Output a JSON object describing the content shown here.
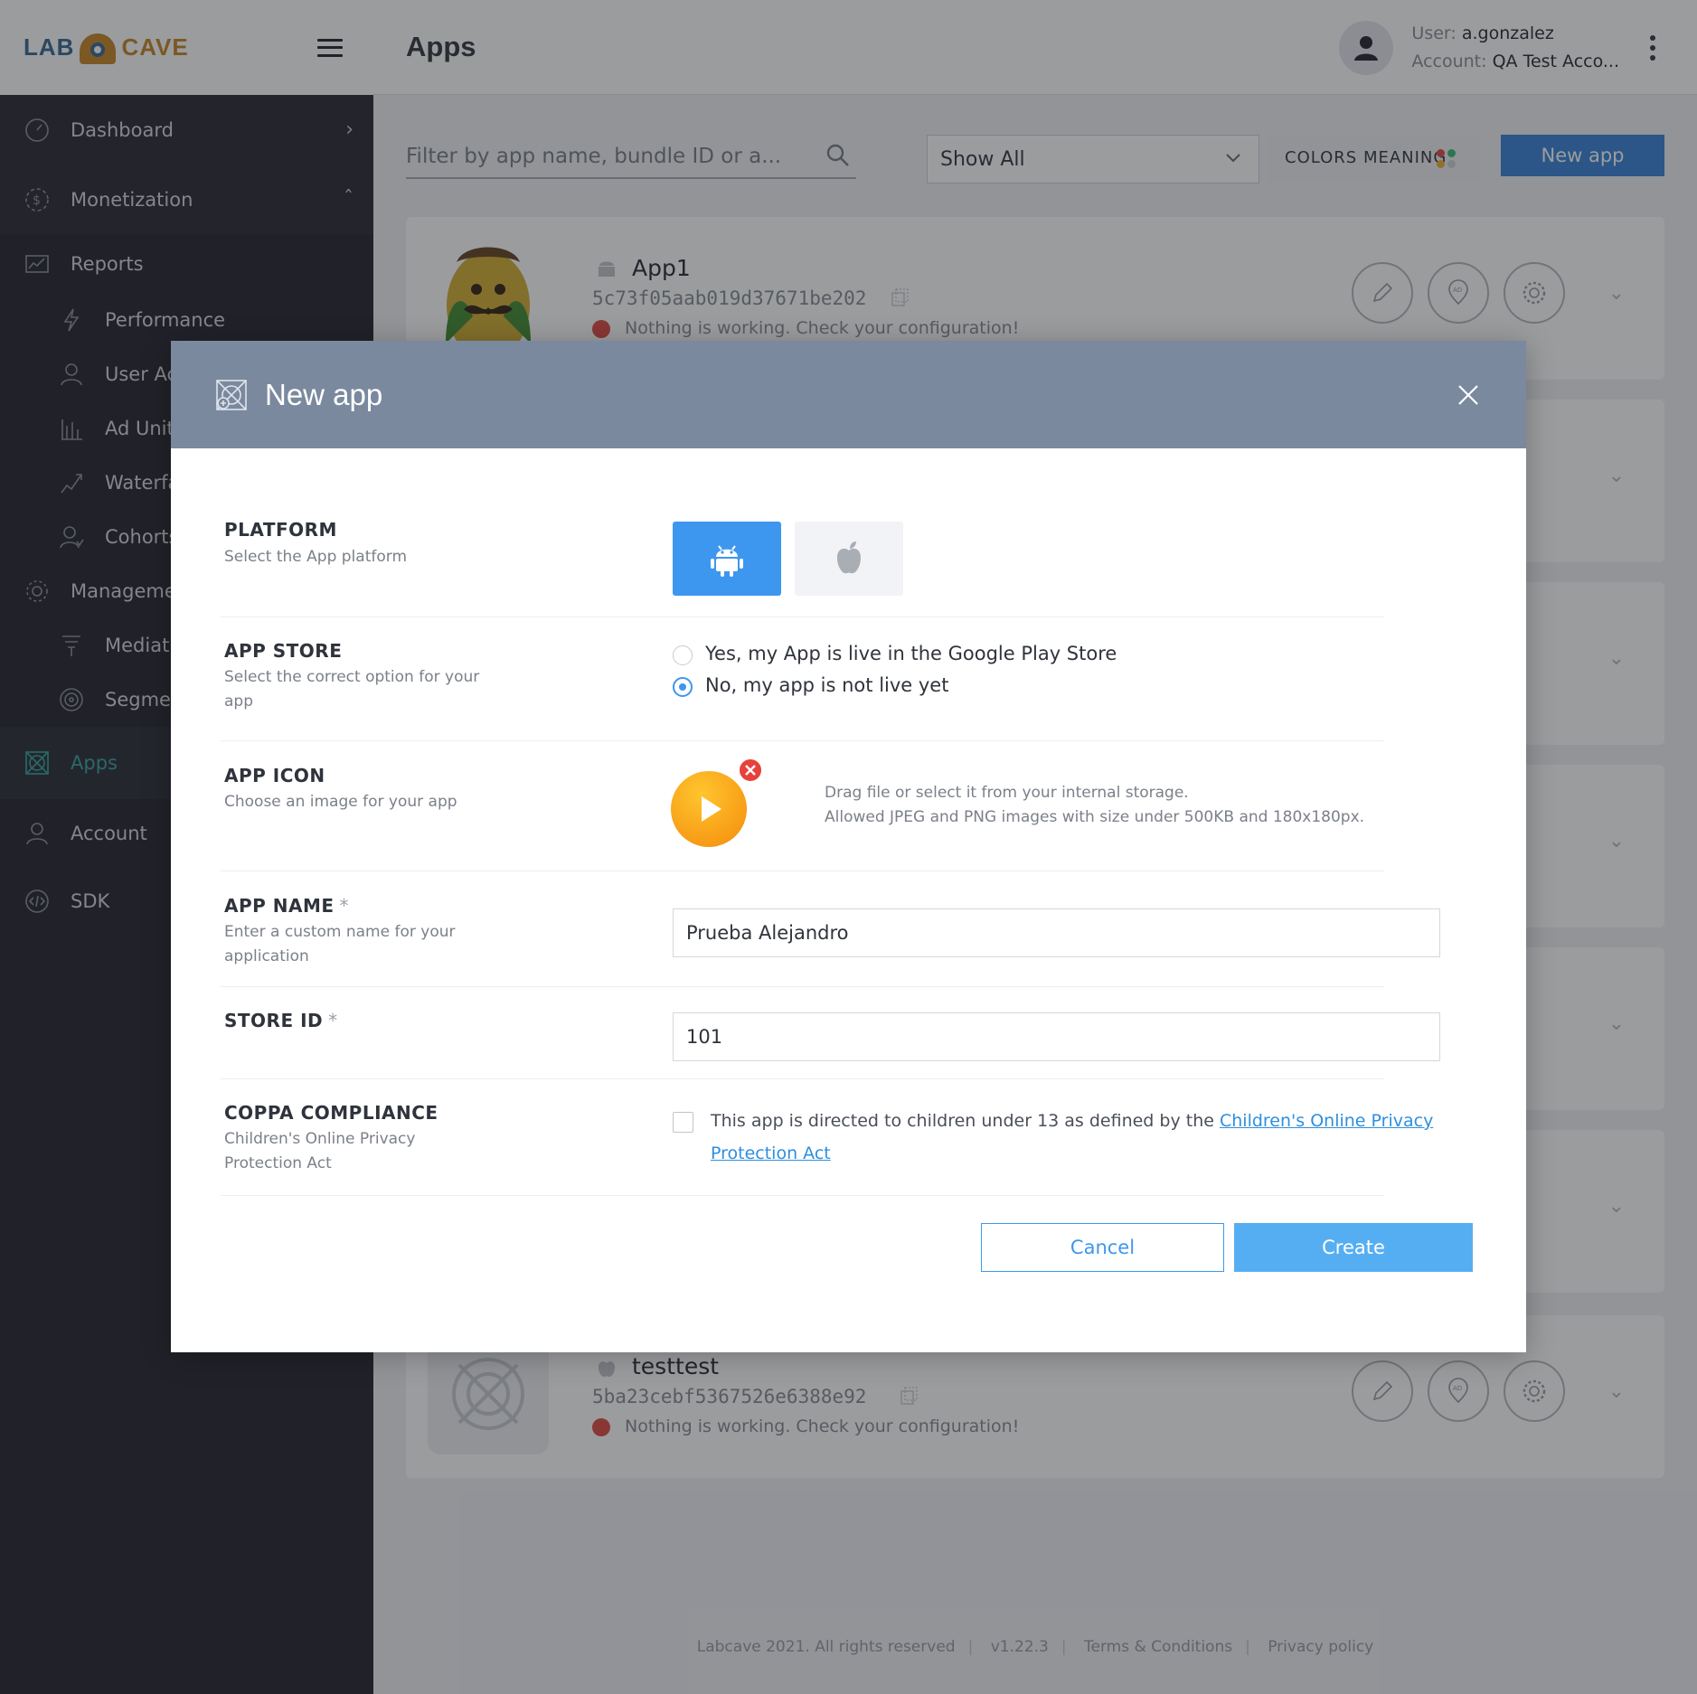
{
  "sidebar": {
    "logo_left": "LAB",
    "logo_right": "CAVE",
    "items": [
      {
        "label": "Dashboard"
      },
      {
        "label": "Monetization"
      },
      {
        "label": "Reports"
      },
      {
        "label": "Performance"
      },
      {
        "label": "User Act"
      },
      {
        "label": "Ad Units"
      },
      {
        "label": "Waterfal"
      },
      {
        "label": "Cohorts"
      },
      {
        "label": "Management"
      },
      {
        "label": "Mediatio"
      },
      {
        "label": "Segment"
      },
      {
        "label": "Apps"
      },
      {
        "label": "Account"
      },
      {
        "label": "SDK"
      }
    ]
  },
  "header": {
    "title": "Apps",
    "user_label": "User:",
    "user_value": "a.gonzalez",
    "account_label": "Account:",
    "account_value": "QA Test Acco..."
  },
  "toolbar": {
    "filter_placeholder": "Filter by app name, bundle ID or a...",
    "show_select": "Show All",
    "colors_meaning": "COLORS MEANING",
    "new_app": "New app"
  },
  "apps": [
    {
      "name": "App1",
      "id": "5c73f05aab019d37671be202",
      "status": "Nothing is working. Check your configuration!"
    },
    {
      "name": "testtest",
      "id": "5ba23cebf5367526e6388e92",
      "status": "Nothing is working. Check your configuration!"
    }
  ],
  "footer": {
    "copyright": "Labcave 2021. All rights reserved",
    "version": "v1.22.3",
    "terms": "Terms & Conditions",
    "privacy": "Privacy policy"
  },
  "modal": {
    "title": "New app",
    "platform": {
      "label": "PLATFORM",
      "desc": "Select the App platform",
      "selected": "android"
    },
    "app_store": {
      "label": "APP STORE",
      "desc": "Select the correct option for your app",
      "options": [
        "Yes, my App is live in the Google Play Store",
        "No, my app is not live yet"
      ],
      "selected_index": 1
    },
    "app_icon": {
      "label": "APP ICON",
      "desc": "Choose an image for your app",
      "hint_line1": "Drag file or select it from your internal storage.",
      "hint_line2": "Allowed JPEG and PNG images with size under 500KB and 180x180px."
    },
    "app_name": {
      "label": "APP NAME",
      "required": "*",
      "desc": "Enter a custom name for your application",
      "value": "Prueba Alejandro"
    },
    "store_id": {
      "label": "STORE ID",
      "required": "*",
      "value": "101"
    },
    "coppa": {
      "label": "COPPA COMPLIANCE",
      "desc": "Children's Online Privacy Protection Act",
      "text": "This app is directed to children under 13 as defined by the ",
      "link": "Children's Online Privacy Protection Act",
      "checked": false
    },
    "cancel": "Cancel",
    "create": "Create"
  },
  "colors": {
    "accent": "#3e97ee",
    "active_nav": "#3fa8a2",
    "status_error": "#e0524b",
    "modal_header": "#7a899e"
  }
}
